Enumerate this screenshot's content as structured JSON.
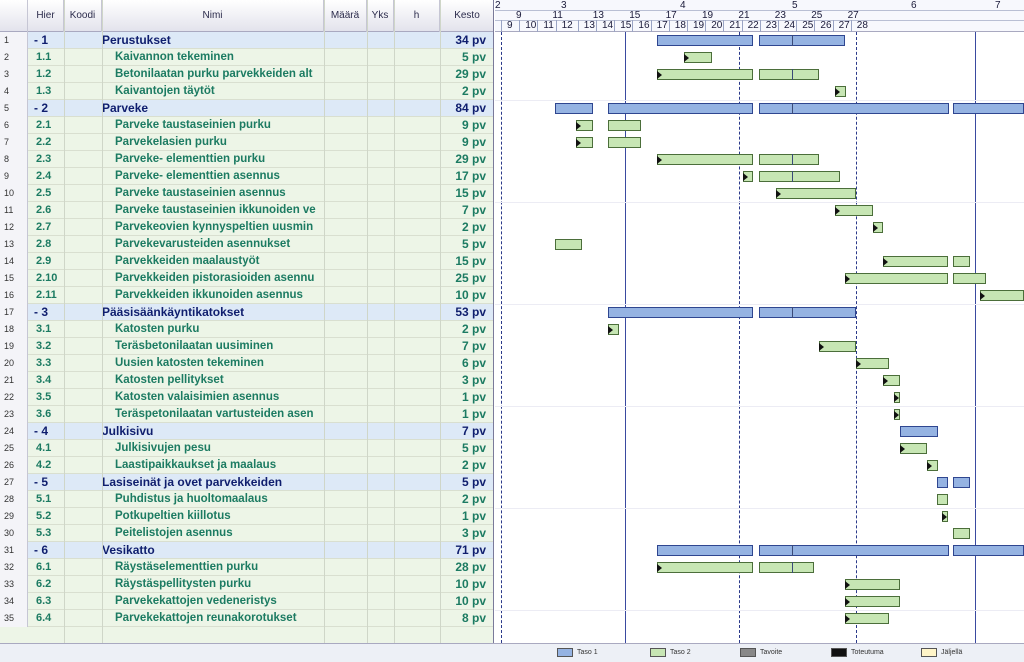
{
  "columns": {
    "hier": "Hier",
    "koodi": "Koodi",
    "nimi": "Nimi",
    "maara": "Määrä",
    "yks": "Yks",
    "h": "h",
    "kesto": "Kesto"
  },
  "timeline": {
    "top_labels": [
      "2",
      "3",
      "4",
      "5",
      "6",
      "7"
    ],
    "day_labels": [
      "9",
      "10",
      "11",
      "12",
      "13",
      "14",
      "15",
      "16",
      "17",
      "18",
      "19",
      "20",
      "21",
      "22",
      "23",
      "24",
      "25",
      "26",
      "27",
      "28"
    ],
    "period_marks": [
      "9",
      "11",
      "13",
      "15",
      "17",
      "19",
      "21",
      "23",
      "25",
      "27"
    ]
  },
  "rows": [
    {
      "num": "1",
      "hier": "- 1",
      "name": "Perustukset",
      "kesto": "34 pv",
      "summary": true
    },
    {
      "num": "2",
      "hier": "1.1",
      "name": "Kaivannon tekeminen",
      "kesto": "5 pv"
    },
    {
      "num": "3",
      "hier": "1.2",
      "name": "Betonilaatan purku parvekkeiden alt",
      "kesto": "29 pv"
    },
    {
      "num": "4",
      "hier": "1.3",
      "name": "Kaivantojen täytöt",
      "kesto": "2 pv"
    },
    {
      "num": "5",
      "hier": "- 2",
      "name": "Parveke",
      "kesto": "84 pv",
      "summary": true
    },
    {
      "num": "6",
      "hier": "2.1",
      "name": "Parveke taustaseinien purku",
      "kesto": "9 pv"
    },
    {
      "num": "7",
      "hier": "2.2",
      "name": "Parvekelasien purku",
      "kesto": "9 pv"
    },
    {
      "num": "8",
      "hier": "2.3",
      "name": "Parveke- elementtien purku",
      "kesto": "29 pv"
    },
    {
      "num": "9",
      "hier": "2.4",
      "name": "Parveke- elementtien asennus",
      "kesto": "17 pv"
    },
    {
      "num": "10",
      "hier": "2.5",
      "name": "Parveke taustaseinien asennus",
      "kesto": "15 pv"
    },
    {
      "num": "11",
      "hier": "2.6",
      "name": "Parveke taustaseinien ikkunoiden ve",
      "kesto": "7 pv"
    },
    {
      "num": "12",
      "hier": "2.7",
      "name": "Parvekeovien kynnyspeltien uusmin",
      "kesto": "2 pv"
    },
    {
      "num": "13",
      "hier": "2.8",
      "name": "Parvekevarusteiden asennukset",
      "kesto": "5 pv"
    },
    {
      "num": "14",
      "hier": "2.9",
      "name": "Parvekkeiden maalaustyöt",
      "kesto": "15 pv"
    },
    {
      "num": "15",
      "hier": "2.10",
      "name": "Parvekkeiden pistorasioiden asennu",
      "kesto": "25 pv"
    },
    {
      "num": "16",
      "hier": "2.11",
      "name": "Parvekkeiden ikkunoiden asennus",
      "kesto": "10 pv"
    },
    {
      "num": "17",
      "hier": "- 3",
      "name": "Pääsisäänkäyntikatokset",
      "kesto": "53 pv",
      "summary": true
    },
    {
      "num": "18",
      "hier": "3.1",
      "name": "Katosten purku",
      "kesto": "2 pv"
    },
    {
      "num": "19",
      "hier": "3.2",
      "name": "Teräsbetonilaatan uusiminen",
      "kesto": "7 pv"
    },
    {
      "num": "20",
      "hier": "3.3",
      "name": "Uusien katosten tekeminen",
      "kesto": "6 pv"
    },
    {
      "num": "21",
      "hier": "3.4",
      "name": "Katosten pellitykset",
      "kesto": "3 pv"
    },
    {
      "num": "22",
      "hier": "3.5",
      "name": "Katosten valaisimien asennus",
      "kesto": "1 pv"
    },
    {
      "num": "23",
      "hier": "3.6",
      "name": "Teräspetonilaatan vartusteiden asen",
      "kesto": "1 pv"
    },
    {
      "num": "24",
      "hier": "- 4",
      "name": "Julkisivu",
      "kesto": "7 pv",
      "summary": true
    },
    {
      "num": "25",
      "hier": "4.1",
      "name": "Julkisivujen pesu",
      "kesto": "5 pv"
    },
    {
      "num": "26",
      "hier": "4.2",
      "name": "Laastipaikkaukset ja maalaus",
      "kesto": "2 pv"
    },
    {
      "num": "27",
      "hier": "- 5",
      "name": "Lasiseinät ja ovet parvekkeiden",
      "kesto": "5 pv",
      "summary": true
    },
    {
      "num": "28",
      "hier": "5.1",
      "name": "Puhdistus ja huoltomaalaus",
      "kesto": "2 pv"
    },
    {
      "num": "29",
      "hier": "5.2",
      "name": "Potkupeltien kiillotus",
      "kesto": "1 pv"
    },
    {
      "num": "30",
      "hier": "5.3",
      "name": "Peitelistojen asennus",
      "kesto": "3 pv"
    },
    {
      "num": "31",
      "hier": "- 6",
      "name": "Vesikatto",
      "kesto": "71 pv",
      "summary": true
    },
    {
      "num": "32",
      "hier": "6.1",
      "name": "Räystäselementtien purku",
      "kesto": "28 pv"
    },
    {
      "num": "33",
      "hier": "6.2",
      "name": "Räystäspellitysten purku",
      "kesto": "10 pv"
    },
    {
      "num": "34",
      "hier": "6.3",
      "name": "Parvekekattojen vedeneristys",
      "kesto": "10 pv"
    },
    {
      "num": "35",
      "hier": "6.4",
      "name": "Parvekekattojen reunakorotukset",
      "kesto": "8 pv"
    }
  ],
  "legend": [
    {
      "label": "Taso 1",
      "color": "#95b3e2"
    },
    {
      "label": "Taso 2",
      "color": "#c7e6b4"
    },
    {
      "label": "Tavoite",
      "color": "#888888"
    },
    {
      "label": "Toteutuma",
      "color": "#111111"
    },
    {
      "label": "Jäljellä",
      "color": "#fff5c8"
    }
  ],
  "colors": {
    "summary_row": "#dde9f7",
    "task_row": "#edf5e7",
    "summary_text": "#0f1e6e",
    "task_text": "#1c7b62",
    "bar_level1": "#95b3e2",
    "bar_level2": "#c7e6b4"
  }
}
